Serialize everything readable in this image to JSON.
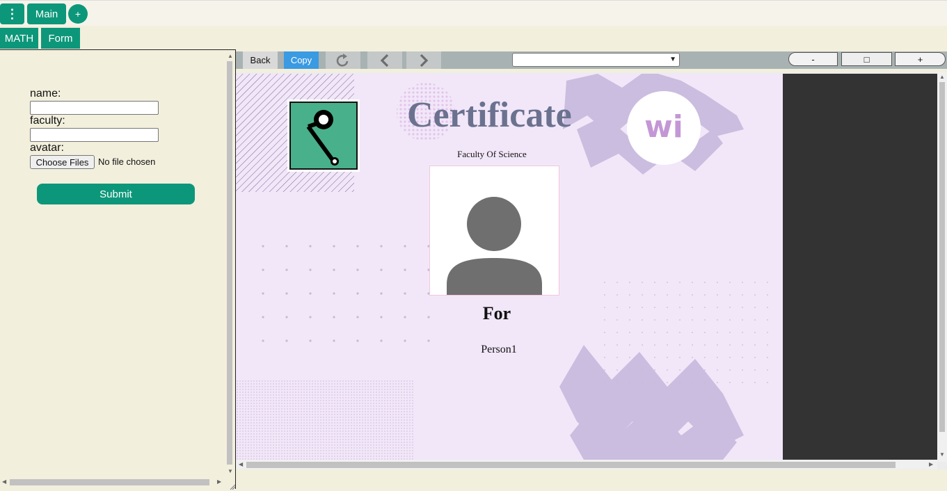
{
  "topbar": {
    "menu_label": "⋮",
    "main_tab": "Main",
    "add_tab": "+"
  },
  "subtabs": {
    "math": "MATH",
    "form": "Form"
  },
  "form": {
    "name_label": "name:",
    "name_value": "",
    "faculty_label": "faculty:",
    "faculty_value": "",
    "avatar_label": "avatar:",
    "file_button": "Choose Files",
    "file_status": "No file chosen",
    "submit": "Submit"
  },
  "toolbar": {
    "back": "Back",
    "copy": "Copy",
    "page_select_value": "",
    "zoom_out": "-",
    "zoom_fit": "□",
    "zoom_in": "+"
  },
  "certificate": {
    "title": "Certificate",
    "faculty": "Faculty Of Science",
    "for_label": "For",
    "person": "Person1",
    "brand_letters": "wi"
  },
  "colors": {
    "accent": "#0d977a",
    "copy_blue": "#3a9ae2",
    "cert_bg": "#f2e7f8",
    "title": "#6b7290",
    "logo_bg": "#48b08a",
    "brand": "#c397d6"
  }
}
